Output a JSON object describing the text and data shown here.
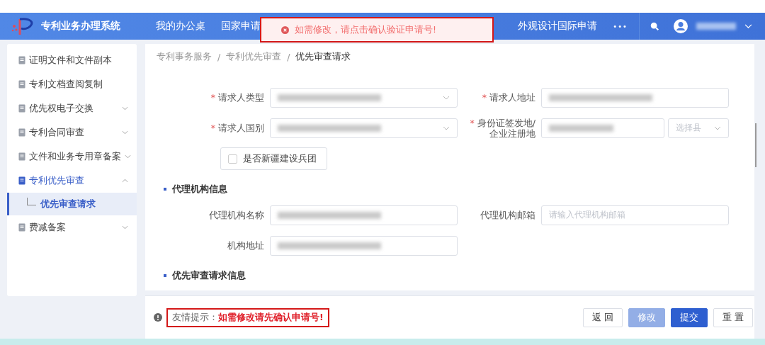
{
  "header": {
    "logo_text": "专利业务办理系统",
    "nav": [
      "我的办公桌",
      "国家申请",
      "外观设计国际申请"
    ],
    "more": "•••"
  },
  "toast": {
    "message": "如需修改，请点击确认验证申请号!"
  },
  "sidebar": {
    "items": [
      {
        "label": "证明文件和文件副本",
        "kind": "link",
        "selected": false
      },
      {
        "label": "专利文档查阅复制",
        "kind": "link",
        "selected": false
      },
      {
        "label": "优先权电子交换",
        "kind": "group",
        "expanded": false,
        "selected": false
      },
      {
        "label": "专利合同审查",
        "kind": "group",
        "expanded": false,
        "selected": false
      },
      {
        "label": "文件和业务专用章备案",
        "kind": "group",
        "expanded": false,
        "selected": false
      },
      {
        "label": "专利优先审查",
        "kind": "group",
        "expanded": true,
        "selected": true,
        "children": [
          {
            "label": "优先审查请求",
            "selected": true
          }
        ]
      },
      {
        "label": "费减备案",
        "kind": "group",
        "expanded": false,
        "selected": false
      }
    ]
  },
  "breadcrumb": {
    "separator": "/",
    "items": [
      "专利事务服务",
      "专利优先审查",
      "优先审查请求"
    ]
  },
  "form": {
    "rows": [
      [
        {
          "label": "请求人类型",
          "marker": "*",
          "kind": "select",
          "redacted": true
        },
        {
          "label": "请求人地址",
          "marker": "*",
          "kind": "input",
          "redacted": true
        }
      ],
      [
        {
          "label": "请求人国别",
          "marker": "*",
          "kind": "select",
          "redacted": true
        },
        {
          "label": "身份证签发地/企业注册地",
          "marker": "*",
          "kind": "region",
          "redacted": true,
          "placeholder": "选择县"
        }
      ]
    ],
    "checkbox": {
      "label": "是否新疆建设兵团",
      "checked": false
    },
    "sections": [
      {
        "title": "代理机构信息",
        "rows": [
          [
            {
              "label": "代理机构名称",
              "kind": "input",
              "redacted": true
            },
            {
              "label": "代理机构邮箱",
              "kind": "input",
              "redacted": false,
              "placeholder": "请输入代理机构邮箱"
            }
          ],
          [
            {
              "label": "机构地址",
              "kind": "input",
              "redacted": true
            }
          ]
        ]
      },
      {
        "title": "优先审查请求信息"
      }
    ]
  },
  "footer": {
    "hint_label": "友情提示：",
    "hint_text": "如需修改请先确认申请号!",
    "buttons": [
      {
        "label": "返 回",
        "kind": "default",
        "disabled": false
      },
      {
        "label": "修改",
        "kind": "primary",
        "disabled": true
      },
      {
        "label": "提交",
        "kind": "primary",
        "disabled": false
      },
      {
        "label": "重 置",
        "kind": "default",
        "disabled": false
      }
    ]
  }
}
